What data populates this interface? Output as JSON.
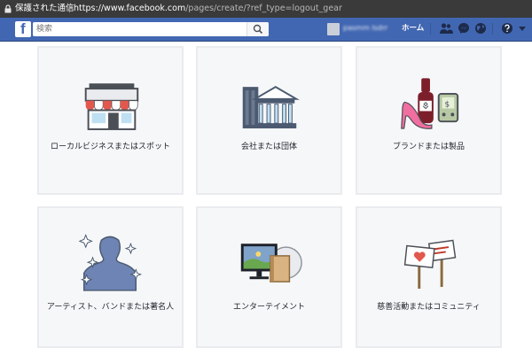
{
  "browser": {
    "secure_label": "保護された通信",
    "separator": "|",
    "url_host": "https://www.facebook.com",
    "url_path": "/pages/create/?ref_type=logout_gear"
  },
  "header": {
    "logo_letter": "f",
    "search_placeholder": "検索",
    "username": "pasmm lsdrr",
    "home_label": "ホーム"
  },
  "categories": [
    {
      "label": "ローカルビジネスまたはスポット",
      "icon": "storefront-icon"
    },
    {
      "label": "会社または団体",
      "icon": "office-building-icon"
    },
    {
      "label": "ブランドまたは製品",
      "icon": "products-icon"
    },
    {
      "label": "アーティスト、バンドまたは著名人",
      "icon": "celebrity-icon"
    },
    {
      "label": "エンターテイメント",
      "icon": "entertainment-icon"
    },
    {
      "label": "慈善活動またはコミュニティ",
      "icon": "community-signs-icon"
    }
  ],
  "colors": {
    "brand_blue": "#4267b2",
    "card_bg": "#f6f7f9",
    "card_border": "#e9ebee"
  }
}
